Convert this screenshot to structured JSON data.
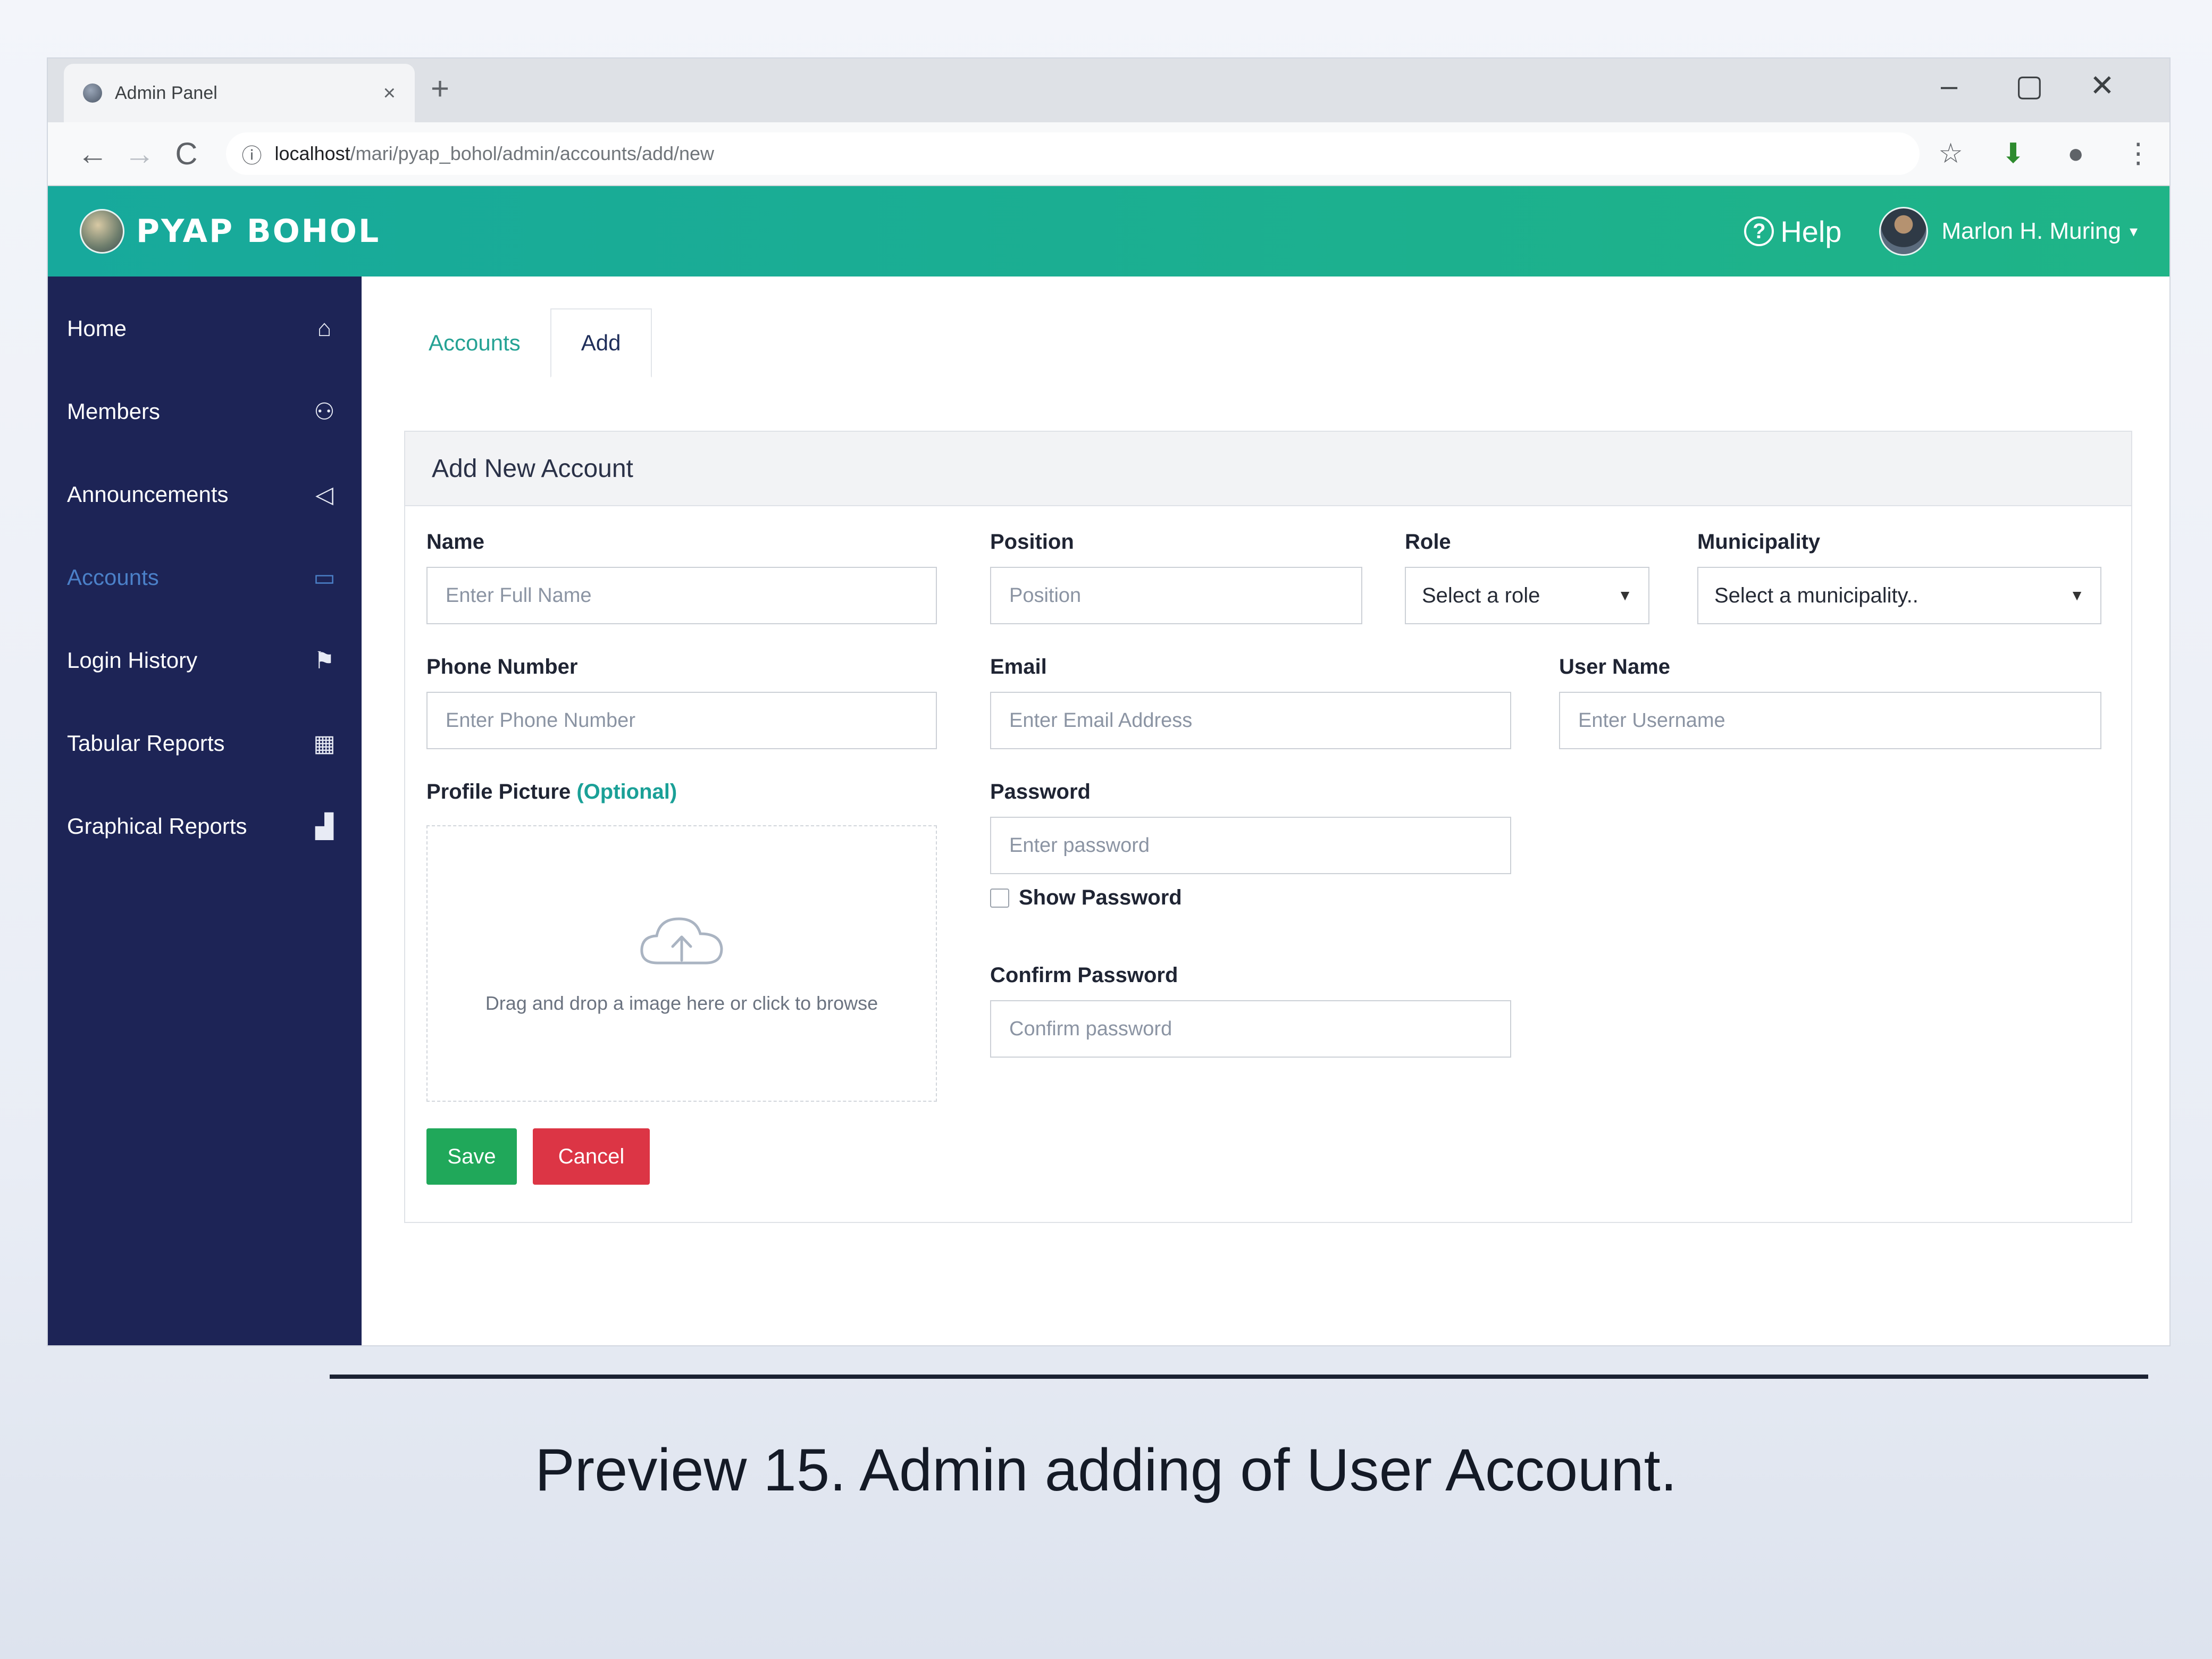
{
  "browser": {
    "tab_title": "Admin Panel",
    "tab_close": "×",
    "new_tab": "+",
    "window_controls": {
      "minimize": "–",
      "maximize": "▢",
      "close": "✕"
    },
    "nav": {
      "back": "←",
      "forward": "→",
      "reload": "C",
      "info": "ⓘ"
    },
    "url_host": "localhost",
    "url_path": "/mari/pyap_bohol/admin/accounts/add/new",
    "addr_icons": [
      "star-icon",
      "extension-icon",
      "profile-icon",
      "menu-icon"
    ],
    "addr_icon_glyphs": {
      "star": "☆",
      "extension": "⬇",
      "profile": "●",
      "menu": "⋮"
    }
  },
  "header": {
    "brand": "PYAP BOHOL",
    "help_label": "Help",
    "help_glyph": "?",
    "user_name": "Marlon H. Muring",
    "caret": "▾",
    "colors": {
      "bar": "#17a99c",
      "sidebar": "#1d2456",
      "active": "#4b80c8"
    }
  },
  "sidebar": {
    "items": [
      {
        "label": "Home",
        "icon": "home-icon",
        "glyph": "⌂"
      },
      {
        "label": "Members",
        "icon": "user-icon",
        "glyph": "⚇"
      },
      {
        "label": "Announcements",
        "icon": "megaphone-icon",
        "glyph": "◁"
      },
      {
        "label": "Accounts",
        "icon": "card-icon",
        "glyph": "▭",
        "active": true
      },
      {
        "label": "Login History",
        "icon": "flag-icon",
        "glyph": "⚑"
      },
      {
        "label": "Tabular Reports",
        "icon": "table-icon",
        "glyph": "▦"
      },
      {
        "label": "Graphical Reports",
        "icon": "bar-chart-icon",
        "glyph": "▟"
      }
    ]
  },
  "main": {
    "tabs": [
      {
        "label": "Accounts"
      },
      {
        "label": "Add"
      }
    ],
    "panel_title": "Add New Account",
    "form": {
      "name": {
        "label": "Name",
        "placeholder": "Enter Full Name"
      },
      "phone": {
        "label": "Phone Number",
        "placeholder": "Enter Phone Number"
      },
      "profile_picture": {
        "label": "Profile Picture",
        "optional": "(Optional)",
        "drop_text": "Drag and drop a image here or click to browse"
      },
      "position": {
        "label": "Position",
        "placeholder": "Position"
      },
      "role": {
        "label": "Role",
        "value": "Select a role"
      },
      "municipality": {
        "label": "Municipality",
        "value": "Select a municipality.."
      },
      "email": {
        "label": "Email",
        "placeholder": "Enter Email Address"
      },
      "username": {
        "label": "User Name",
        "placeholder": "Enter Username"
      },
      "password": {
        "label": "Password",
        "placeholder": "Enter password",
        "show_label": "Show Password"
      },
      "confirm_password": {
        "label": "Confirm Password",
        "placeholder": "Confirm password"
      },
      "save_label": "Save",
      "cancel_label": "Cancel"
    }
  },
  "caption": "Preview 15. Admin adding of User Account."
}
